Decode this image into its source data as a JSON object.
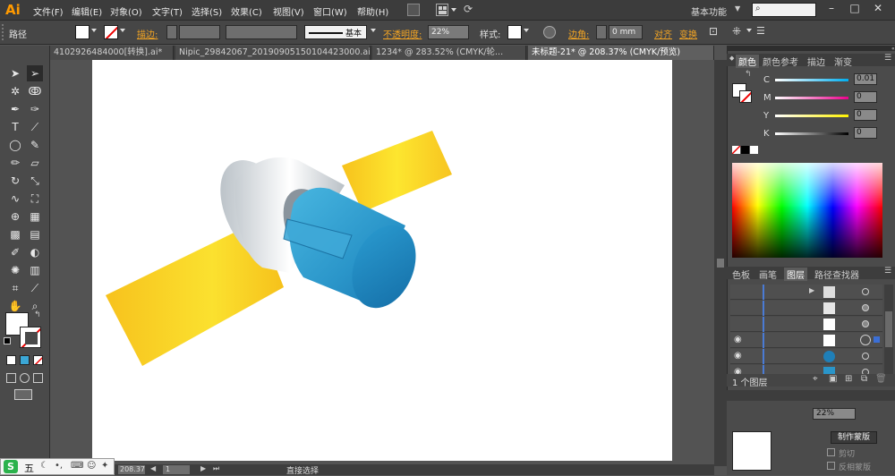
{
  "app": {
    "logo": "Ai"
  },
  "menu": [
    "文件(F)",
    "编辑(E)",
    "对象(O)",
    "文字(T)",
    "选择(S)",
    "效果(C)",
    "视图(V)",
    "窗口(W)",
    "帮助(H)"
  ],
  "workspace": "基本功能",
  "control": {
    "path_label": "路径",
    "stroke_label": "描边:",
    "stroke_style": "基本",
    "opacity_label": "不透明度:",
    "opacity_value": "22%",
    "style_label": "样式:",
    "corner_label": "边角:",
    "corner_value": "0 mm",
    "align_label": "对齐",
    "transform_label": "变换"
  },
  "tabs": [
    "4102926484000[转换].ai*",
    "Nipic_29842067_20190905150104423000.ai",
    "1234* @ 283.52% (CMYK/轮...",
    "未标题-21* @ 208.37% (CMYK/预览)"
  ],
  "color_panel": {
    "tabs": [
      "颜色",
      "颜色参考",
      "描边",
      "渐变"
    ],
    "channels": [
      {
        "name": "C",
        "value": "0.01",
        "color": "#00aeef"
      },
      {
        "name": "M",
        "value": "0",
        "color": "#ec008c"
      },
      {
        "name": "Y",
        "value": "0",
        "color": "#fff200"
      },
      {
        "name": "K",
        "value": "0",
        "color": "#000000"
      }
    ]
  },
  "layers_panel": {
    "tabs": [
      "色板",
      "画笔",
      "图层",
      "路径查找器"
    ],
    "footer": "1 个图层"
  },
  "lower_panel": {
    "opacity_value": "22%",
    "make_mask": "制作蒙版",
    "clip": "剪切",
    "invert_mask": "反相蒙版"
  },
  "status": {
    "zoom": "208.37%",
    "page": "1",
    "tool_name": "直接选择"
  },
  "ime": {
    "mode": "五"
  },
  "colors": {
    "accent": "#ff9a00",
    "panel": "#4b4b4b",
    "menubar": "#3c3c3c"
  }
}
